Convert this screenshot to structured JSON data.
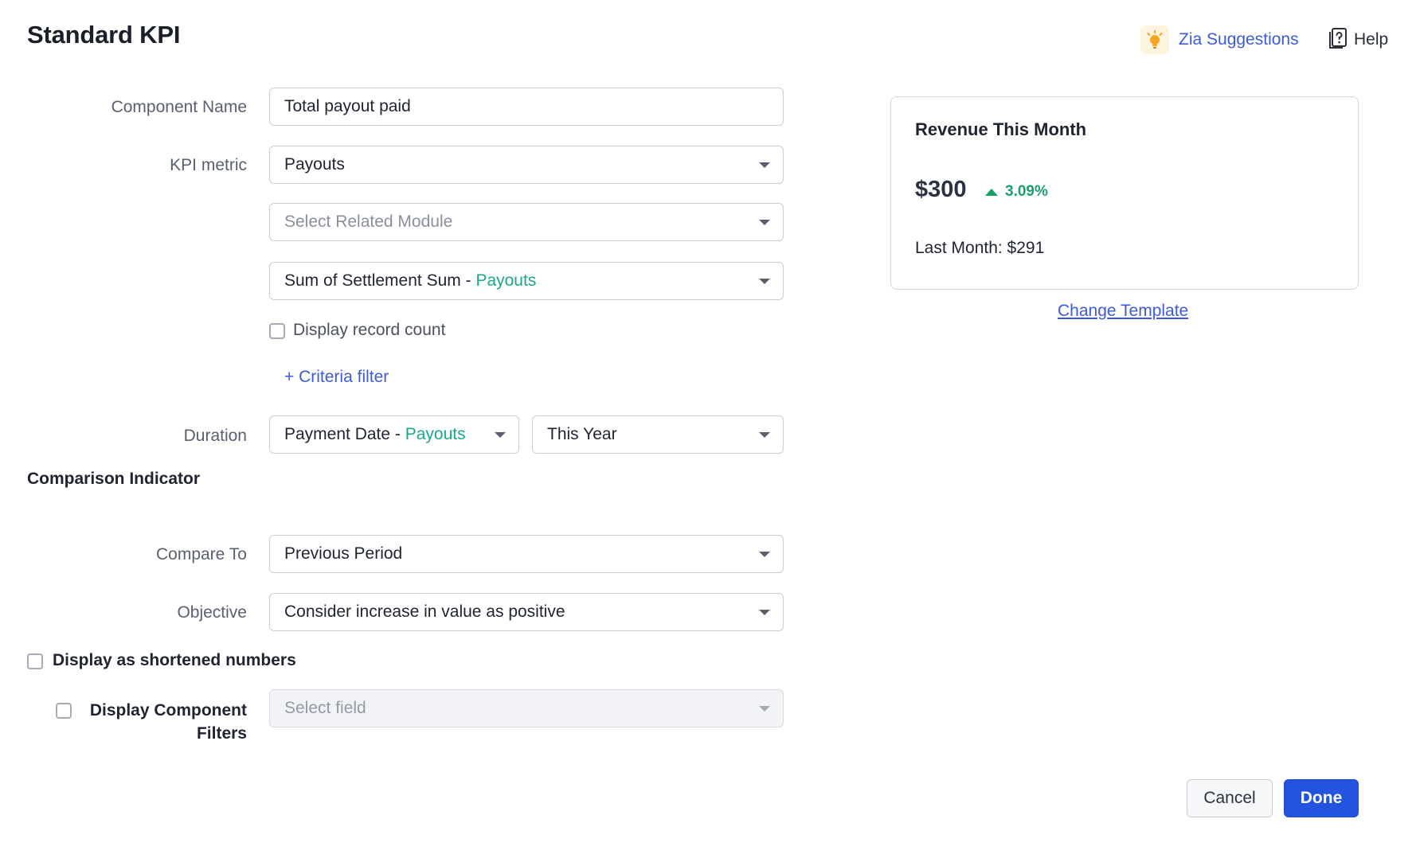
{
  "header": {
    "title": "Standard KPI",
    "zia_label": "Zia Suggestions",
    "help_label": "Help"
  },
  "form": {
    "component_name": {
      "label": "Component Name",
      "value": "Total payout paid"
    },
    "kpi_metric": {
      "label": "KPI metric",
      "module_value": "Payouts",
      "related_module_placeholder": "Select Related Module",
      "aggregate_prefix": "Sum of Settlement Sum - ",
      "aggregate_module": "Payouts"
    },
    "display_record_count_label": "Display record count",
    "criteria_filter_label": "+ Criteria filter",
    "duration": {
      "label": "Duration",
      "field_prefix": "Payment Date - ",
      "field_module": "Payouts",
      "period_value": "This Year"
    },
    "comparison_section_title": "Comparison Indicator",
    "compare_to": {
      "label": "Compare To",
      "value": "Previous Period"
    },
    "objective": {
      "label": "Objective",
      "value": "Consider increase in value as positive"
    },
    "shortened_numbers_label": "Display as shortened numbers",
    "component_filters": {
      "label_line1": "Display Component",
      "label_line2": "Filters",
      "placeholder": "Select field"
    }
  },
  "preview": {
    "title": "Revenue This Month",
    "value": "$300",
    "trend": "3.09%",
    "last_month": "Last Month: $291",
    "change_template_label": "Change Template"
  },
  "footer": {
    "cancel_label": "Cancel",
    "done_label": "Done"
  },
  "colors": {
    "accent_blue": "#3d5bdb",
    "primary_button": "#2354e0",
    "module_teal": "#1aa88b",
    "trend_green": "#1a9e6a",
    "zia_orange": "#f5a623"
  },
  "icons": {
    "zia": "lightbulb-icon",
    "help": "help-document-icon",
    "dropdown": "caret-down-icon",
    "trend": "triangle-up-icon"
  }
}
